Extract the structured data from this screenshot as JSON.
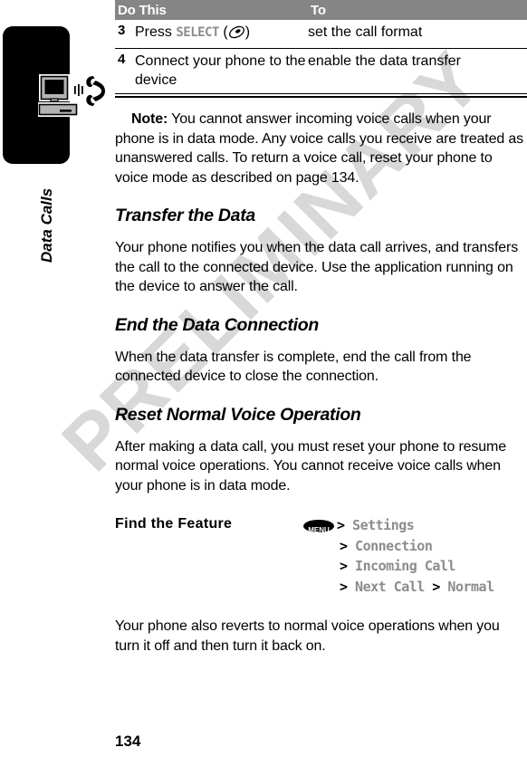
{
  "chapter": {
    "label": "Data Calls",
    "icon": "computer-phone-icon"
  },
  "watermark": {
    "text": "PRELIMINARY"
  },
  "step_table": {
    "headers": [
      "Do This",
      "To"
    ],
    "rows": [
      {
        "number": "3",
        "do_prefix": "Press ",
        "do_softkey": "SELECT",
        "do_suffix_open": " (",
        "do_suffix_close": ")",
        "to": "set the call format"
      },
      {
        "number": "4",
        "do_prefix": "Connect your phone to the device",
        "do_softkey": "",
        "do_suffix_open": "",
        "do_suffix_close": "",
        "to": "enable the data transfer"
      }
    ]
  },
  "note": {
    "label": "Note:",
    "text": " You cannot answer incoming voice calls when your phone is in data mode. Any voice calls you receive are treated as unanswered calls. To return a voice call, reset your phone to voice mode as described on page 134."
  },
  "sections": [
    {
      "heading": "Transfer the Data",
      "body": "Your phone notifies you when the data call arrives, and transfers the call to the connected device. Use the application running on the device to answer the call."
    },
    {
      "heading": "End the Data Connection",
      "body": "When the data transfer is complete, end the call from the connected device to close the connection."
    },
    {
      "heading": "Reset Normal Voice Operation",
      "body": "After making a data call, you must reset your phone to resume normal voice operations. You cannot receive voice calls when your phone is in data mode."
    }
  ],
  "find_the_feature": {
    "label": "Find the Feature",
    "menu_badge": "MENU",
    "path_lines": [
      "> Settings",
      "> Connection",
      "> Incoming Call",
      "> Next Call > Normal"
    ]
  },
  "closing_paragraph": "Your phone also reverts to normal voice operations when you turn it off and then turn it back on.",
  "page_number": "134",
  "colors": {
    "table_header_bg": "#858585",
    "softkey_gray": "#8c8c8c",
    "watermark_gray": "#d8d8d8",
    "tab_black": "#000000"
  }
}
